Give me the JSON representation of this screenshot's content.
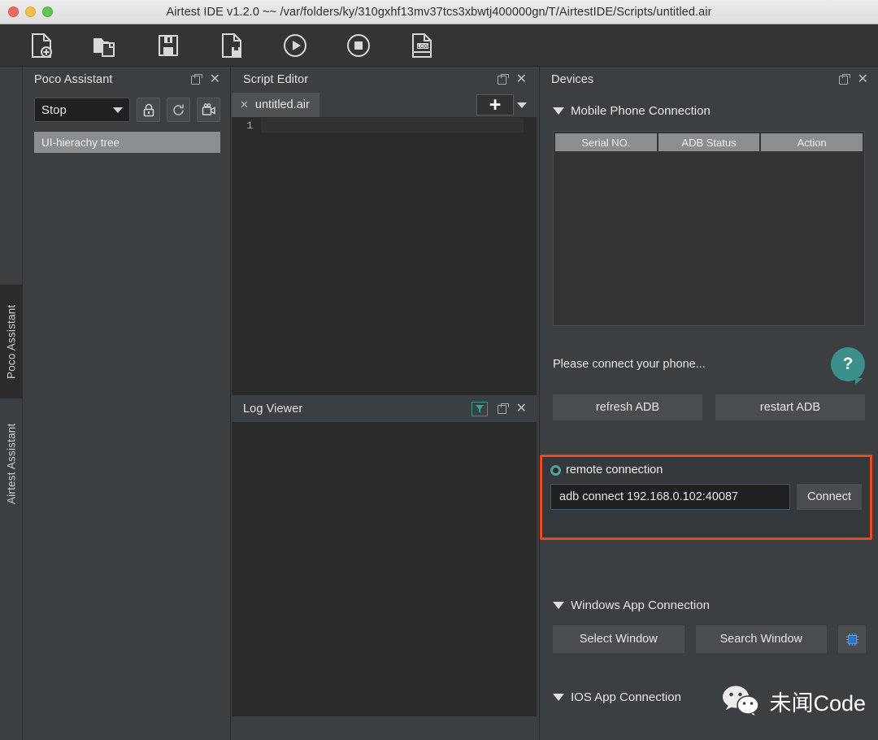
{
  "window": {
    "title": "Airtest IDE v1.2.0 ~~ /var/folders/ky/310gxhf13mv37tcs3xbwtj400000gn/T/AirtestIDE/Scripts/untitled.air"
  },
  "toolbar": {
    "buttons": [
      {
        "name": "new-script-icon",
        "label": "New Script"
      },
      {
        "name": "open-folder-icon",
        "label": "Open Script"
      },
      {
        "name": "save-icon",
        "label": "Save Script"
      },
      {
        "name": "save-as-icon",
        "label": "Save As"
      },
      {
        "name": "run-icon",
        "label": "Run Script"
      },
      {
        "name": "stop-icon",
        "label": "Stop Script"
      },
      {
        "name": "log-icon",
        "label": "View Log"
      }
    ]
  },
  "rail": {
    "tabs": [
      {
        "label": "Poco Assistant",
        "active": true
      },
      {
        "label": "Airtest Assistant",
        "active": false
      }
    ]
  },
  "poco": {
    "title": "Poco Assistant",
    "mode_select": {
      "value": "Stop"
    },
    "tools": [
      {
        "name": "lock-icon",
        "label": "Lock"
      },
      {
        "name": "refresh-icon",
        "label": "Refresh"
      },
      {
        "name": "screen-record-icon",
        "label": "Record"
      }
    ],
    "tree_item": "UI-hierachy tree"
  },
  "editor": {
    "title": "Script Editor",
    "tab_label": "untitled.air",
    "line_numbers": [
      "1"
    ],
    "code_lines": [
      ""
    ]
  },
  "log_viewer": {
    "title": "Log Viewer",
    "filter_label": "Filter"
  },
  "devices": {
    "title": "Devices",
    "mobile_section": "Mobile Phone Connection",
    "table": {
      "headers": [
        "Serial NO.",
        "ADB Status",
        "Action"
      ],
      "rows": []
    },
    "status_message": "Please connect your phone...",
    "help_glyph": "?",
    "adb_buttons": [
      "refresh ADB",
      "restart ADB"
    ],
    "remote": {
      "label": "remote connection",
      "input_value": "adb connect 192.168.0.102:40087",
      "input_placeholder": "adb connect 192.168.0.102:40087",
      "connect_label": "Connect",
      "highlight_color": "#e8491f"
    },
    "windows_section": "Windows App Connection",
    "windows_buttons": [
      "Select Window",
      "Search Window"
    ],
    "chip_icon": "select-target-icon",
    "ios_section": "IOS App Connection"
  },
  "watermark": {
    "icon": "wechat-icon",
    "text": "未闻Code"
  },
  "colors": {
    "panel_bg": "#3c3f41",
    "editor_bg": "#2b2b2b",
    "accent_orange": "#e8491f",
    "accent_teal": "#3c8f8a",
    "header_gray": "#8b8e90"
  }
}
